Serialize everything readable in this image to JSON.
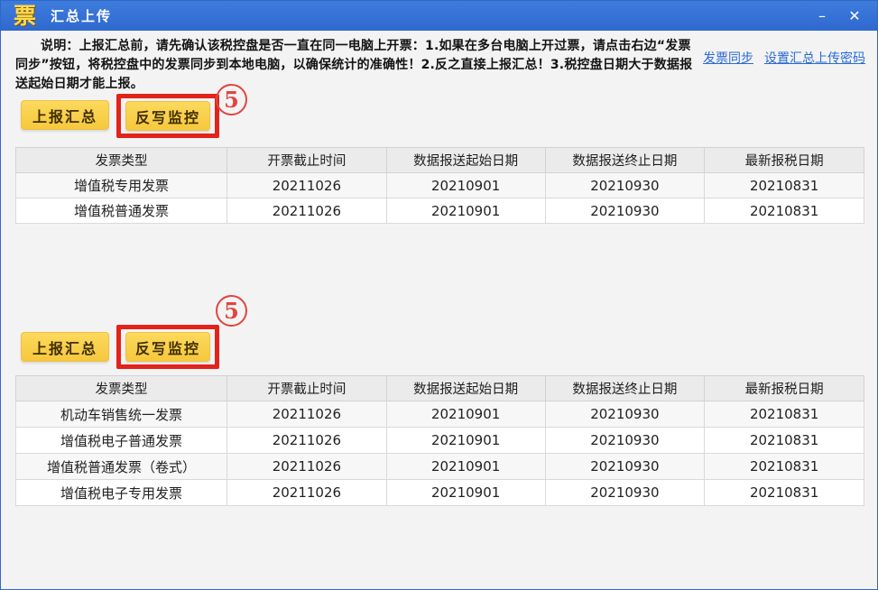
{
  "window": {
    "title": "汇总上传",
    "logo": "票",
    "minimize": "–",
    "close": "✕"
  },
  "note": {
    "text": "说明：上报汇总前，请先确认该税控盘是否一直在同一电脑上开票：1.如果在多台电脑上开过票，请点击右边“发票同步”按钮，将税控盘中的发票同步到本地电脑，以确保统计的准确性！2.反之直接上报汇总！3.税控盘日期大于数据报送起始日期才能上报。"
  },
  "links": [
    {
      "label": "发票同步"
    },
    {
      "label": "设置汇总上传密码"
    }
  ],
  "buttons": {
    "report": "上报汇总",
    "rewrite": "反写监控"
  },
  "annotation": {
    "number": "5"
  },
  "colors": {
    "titlebar_blue": "#3472d6",
    "button_yellow": "#f8cf48",
    "highlight_red": "#e2231a",
    "link_blue": "#2b6bd3"
  },
  "tables": {
    "headers": [
      "发票类型",
      "开票截止时间",
      "数据报送起始日期",
      "数据报送终止日期",
      "最新报税日期"
    ],
    "table1": {
      "rows": [
        [
          "增值税专用发票",
          "20211026",
          "20210901",
          "20210930",
          "20210831"
        ],
        [
          "增值税普通发票",
          "20211026",
          "20210901",
          "20210930",
          "20210831"
        ]
      ]
    },
    "table2": {
      "rows": [
        [
          "机动车销售统一发票",
          "20211026",
          "20210901",
          "20210930",
          "20210831"
        ],
        [
          "增值税电子普通发票",
          "20211026",
          "20210901",
          "20210930",
          "20210831"
        ],
        [
          "增值税普通发票（卷式）",
          "20211026",
          "20210901",
          "20210930",
          "20210831"
        ],
        [
          "增值税电子专用发票",
          "20211026",
          "20210901",
          "20210930",
          "20210831"
        ]
      ]
    }
  }
}
